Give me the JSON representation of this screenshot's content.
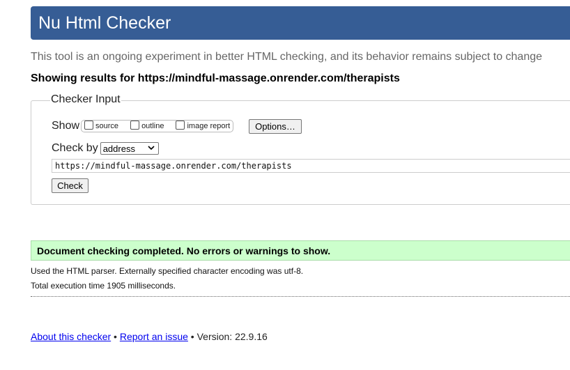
{
  "header": {
    "title": "Nu Html Checker"
  },
  "intro": {
    "subtitle": "This tool is an ongoing experiment in better HTML checking, and its behavior remains subject to change",
    "results_for": "Showing results for https://mindful-massage.onrender.com/therapists"
  },
  "checker_input": {
    "legend": "Checker Input",
    "show_label": "Show",
    "show_options": [
      {
        "label": "source",
        "checked": false
      },
      {
        "label": "outline",
        "checked": false
      },
      {
        "label": "image report",
        "checked": false
      }
    ],
    "options_button": "Options…",
    "check_by_label": "Check by",
    "check_by_value": "address",
    "url_value": "https://mindful-massage.onrender.com/therapists",
    "check_button": "Check"
  },
  "result": {
    "message": "Document checking completed. No errors or warnings to show.",
    "parser_info": "Used the HTML parser. Externally specified character encoding was utf-8.",
    "execution_time": "Total execution time 1905 milliseconds.",
    "status_color": "#ccffcc"
  },
  "footer": {
    "about_link": "About this checker",
    "separator1": " • ",
    "report_link": "Report an issue",
    "separator2": " • ",
    "version": "Version: 22.9.16"
  },
  "colors": {
    "header_bg": "#365d95",
    "link": "#0000ee"
  }
}
